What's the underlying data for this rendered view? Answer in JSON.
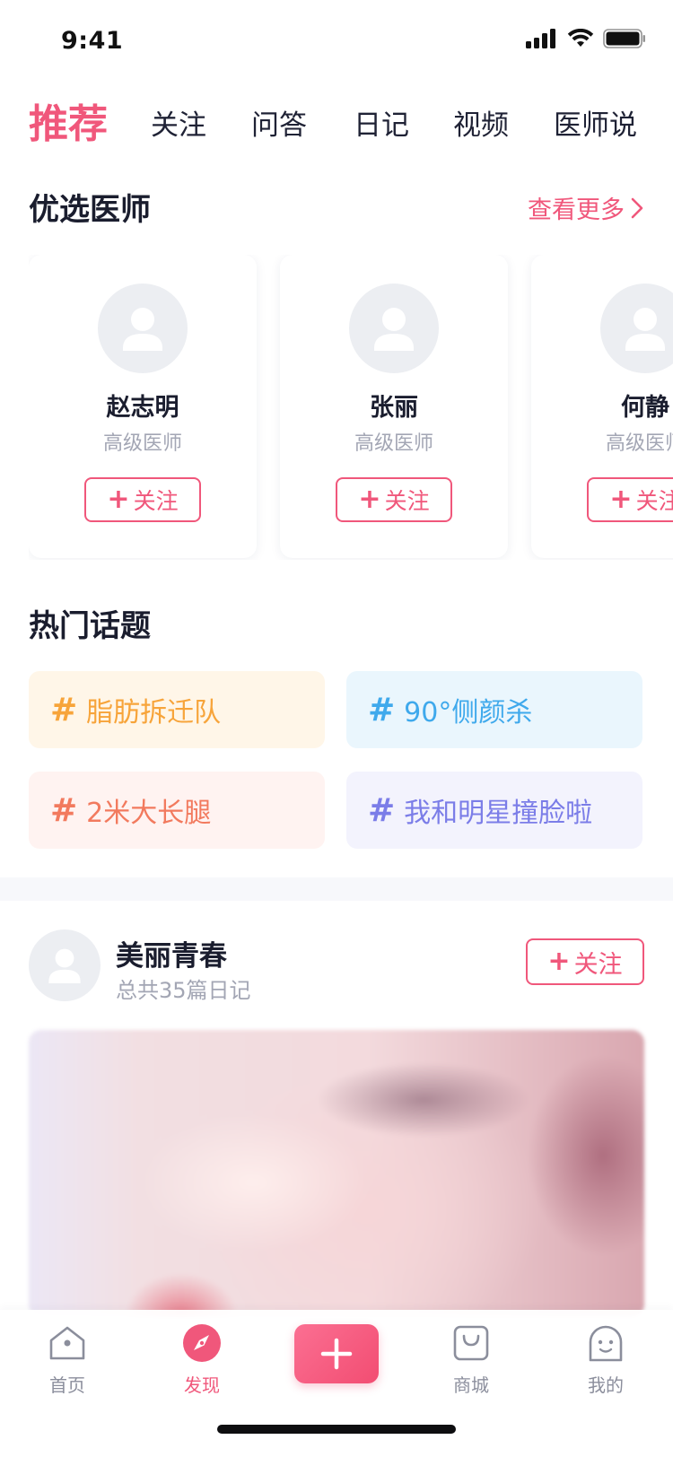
{
  "status_bar": {
    "time": "9:41"
  },
  "nav_tabs": [
    {
      "label": "推荐",
      "active": true
    },
    {
      "label": "关注"
    },
    {
      "label": "问答"
    },
    {
      "label": "日记"
    },
    {
      "label": "视频"
    },
    {
      "label": "医师说"
    }
  ],
  "doctors_section": {
    "title": "优选医师",
    "see_more": "查看更多",
    "doctors": [
      {
        "name": "赵志明",
        "title": "高级医师",
        "follow_label": "关注"
      },
      {
        "name": "张丽",
        "title": "高级医师",
        "follow_label": "关注"
      },
      {
        "name": "何静",
        "title": "高级医师",
        "follow_label": "关注"
      }
    ]
  },
  "topics_section": {
    "title": "热门话题",
    "topics": [
      {
        "label": "脂肪拆迁队",
        "color": "#f7a43a",
        "bg": "#fff6e8"
      },
      {
        "label": "90°侧颜杀",
        "color": "#3fa9ec",
        "bg": "#eaf6fd"
      },
      {
        "label": "2米大长腿",
        "color": "#f27a5e",
        "bg": "#fff3f1"
      },
      {
        "label": "我和明星撞脸啦",
        "color": "#7b7de8",
        "bg": "#f3f3fd"
      }
    ],
    "hash_symbol": "#"
  },
  "diary": {
    "user": "美丽青春",
    "count_text": "总共35篇日记",
    "follow_label": "关注"
  },
  "tab_bar": {
    "items": [
      {
        "label": "首页",
        "icon": "home-icon"
      },
      {
        "label": "发现",
        "icon": "compass-icon",
        "active": true
      },
      {
        "label": "",
        "icon": "plus-icon"
      },
      {
        "label": "商城",
        "icon": "shopping-bag-icon"
      },
      {
        "label": "我的",
        "icon": "face-icon"
      }
    ]
  },
  "colors": {
    "accent": "#f0577b",
    "text_primary": "#1a1d2e",
    "text_secondary": "#a3a6b4"
  }
}
